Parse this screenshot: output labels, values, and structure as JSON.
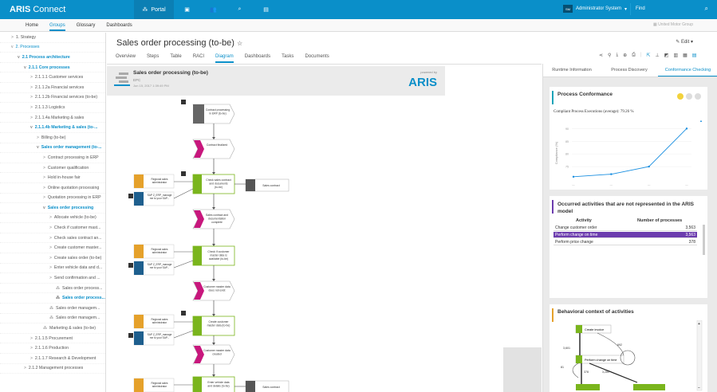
{
  "app": {
    "name": "ARIS",
    "name2": " Connect"
  },
  "topnav": {
    "portal": "Portal"
  },
  "topright": {
    "avatar": "SM",
    "user": "Administrator System",
    "find_placeholder": "Find"
  },
  "subbar": {
    "tabs": [
      "Home",
      "Groups",
      "Glossary",
      "Dashboards"
    ],
    "active_tab": "Groups",
    "group": "United Motor Group"
  },
  "tree": [
    {
      "label": "1. Strategy",
      "indent": 0,
      "chev": ">"
    },
    {
      "label": "2. Processes",
      "indent": 0,
      "chev": "v",
      "hl": true
    },
    {
      "label": "2.1 Process architecture",
      "indent": 1,
      "chev": "v",
      "hl": true,
      "bold": true
    },
    {
      "label": "2.1.1 Core processes",
      "indent": 2,
      "chev": "v",
      "hl": true,
      "bold": true
    },
    {
      "label": "2.1.1.1 Customer services",
      "indent": 3,
      "chev": ">"
    },
    {
      "label": "2.1.1.2a Financial services",
      "indent": 3,
      "chev": ">"
    },
    {
      "label": "2.1.1.2b Financial services (to-be)",
      "indent": 3,
      "chev": ">"
    },
    {
      "label": "2.1.1.3 Logistics",
      "indent": 3,
      "chev": ">"
    },
    {
      "label": "2.1.1.4a Marketing & sales",
      "indent": 3,
      "chev": ">"
    },
    {
      "label": "2.1.1.4b Marketing & sales (to-...",
      "indent": 3,
      "chev": "v",
      "hl": true,
      "bold": true
    },
    {
      "label": "Billing (to-be)",
      "indent": 4,
      "chev": ">"
    },
    {
      "label": "Sales order management (to-...",
      "indent": 4,
      "chev": "v",
      "hl": true,
      "bold": true
    },
    {
      "label": "Contract processing in ERP",
      "indent": 5,
      "chev": ">"
    },
    {
      "label": "Customer qualification",
      "indent": 5,
      "chev": ">"
    },
    {
      "label": "Hold in-house fair",
      "indent": 5,
      "chev": ">"
    },
    {
      "label": "Online quotation processing",
      "indent": 5,
      "chev": ">"
    },
    {
      "label": "Quotation processing in ERP",
      "indent": 5,
      "chev": ">"
    },
    {
      "label": "Sales order processing",
      "indent": 5,
      "chev": "v",
      "hl": true,
      "bold": true
    },
    {
      "label": "Allocate vehicle (to-be)",
      "indent": 6,
      "chev": ">"
    },
    {
      "label": "Check if customer mast...",
      "indent": 6,
      "chev": ">"
    },
    {
      "label": "Check sales contract an...",
      "indent": 6,
      "chev": ">"
    },
    {
      "label": "Create customer master...",
      "indent": 6,
      "chev": ">"
    },
    {
      "label": "Create sales order (to-be)",
      "indent": 6,
      "chev": ">"
    },
    {
      "label": "Enter vehicle data and d...",
      "indent": 6,
      "chev": ">"
    },
    {
      "label": "Send confirmation and ...",
      "indent": 6,
      "chev": ">"
    },
    {
      "label": "Sales order process...",
      "indent": 7,
      "chev": "⁂"
    },
    {
      "label": "Sales order process...",
      "indent": 7,
      "chev": "⁂",
      "hl": true,
      "bold": true
    },
    {
      "label": "Sales order managem...",
      "indent": 6,
      "chev": "⁂"
    },
    {
      "label": "Sales order managem...",
      "indent": 6,
      "chev": "⁂"
    },
    {
      "label": "Marketing & sales (to-be)",
      "indent": 5,
      "chev": "⁂"
    },
    {
      "label": "2.1.1.5 Procurement",
      "indent": 3,
      "chev": ">"
    },
    {
      "label": "2.1.1.6 Production",
      "indent": 3,
      "chev": ">"
    },
    {
      "label": "2.1.1.7 Research & Development",
      "indent": 3,
      "chev": ">"
    },
    {
      "label": "2.1.2 Management processes",
      "indent": 2,
      "chev": ">"
    }
  ],
  "page": {
    "title": "Sales order processing (to-be)",
    "edit": "Edit"
  },
  "tabs": [
    "Overview",
    "Steps",
    "Table",
    "RACI",
    "Diagram",
    "Dashboards",
    "Tasks",
    "Documents"
  ],
  "active_tab": "Diagram",
  "diagram_header": {
    "title": "Sales order processing (to-be)",
    "type": "EPC",
    "date": "Jun 15, 2017 1:39:49 PM",
    "powered": "powered by",
    "brand": "ARIS"
  },
  "diagram": {
    "events": [
      "Contract processing in ERP (to-be)",
      "Contract finalized",
      "Sales contract and documentation complete",
      "Customer master data does not exist",
      "Customer master data created"
    ],
    "functions": [
      "Check sales contract and documents (to-be)",
      "Check if customer master data is available (to-be)",
      "Create customer master data (to-be)",
      "Enter vehicle data and details (to-be)"
    ],
    "roles": [
      "Regional sales administrator",
      "Regional sales administrator",
      "Regional sales administrator",
      "Regional sales administrator"
    ],
    "systems": [
      "SAP Z_ERP_manage me to your SAP...",
      "SAP Z_ERP_manage me to your SAP...",
      "SAP Z_ERP_manage me to your SAP..."
    ],
    "docs": [
      "Sales contract",
      "Sales contract"
    ]
  },
  "right_tabs": [
    "Runtime Information",
    "Process Discovery",
    "Conformance Checking"
  ],
  "right_active": "Conformance Checking",
  "conformance": {
    "title": "Process Conformance",
    "subtitle": "Compliant Process Executions (average): 79.26 %",
    "ylabel": "Compliance (%)"
  },
  "chart_data": {
    "type": "line",
    "ylabel": "Compliance (%)",
    "values": [
      71,
      72,
      75,
      90
    ],
    "ylim": [
      70,
      92
    ],
    "yticks": [
      "75",
      "80",
      "85",
      "90"
    ]
  },
  "occurred": {
    "title": "Occurred activities that are not represented in the ARIS model",
    "col1": "Activity",
    "col2": "Number of processes",
    "rows": [
      {
        "a": "Change customer order",
        "n": "3,563"
      },
      {
        "a": "Perform change on time",
        "n": "3,563",
        "sel": true
      },
      {
        "a": "Perform price change",
        "n": "378"
      }
    ]
  },
  "behavioral": {
    "title": "Behavioral context of activities",
    "nodes": [
      "Create invoice",
      "Perform change on time"
    ],
    "edges": [
      "3,601",
      "692",
      "81",
      "378",
      "3,280"
    ]
  },
  "colors": {
    "brand": "#0a8fc9",
    "function": "#7ab51d",
    "event": "#c8177d",
    "role": "#e5a12b",
    "system": "#1e5f8e",
    "card_bar_teal": "#1aa3b8",
    "card_bar_purple": "#6c3cae",
    "card_bar_orange": "#e5a12b"
  }
}
